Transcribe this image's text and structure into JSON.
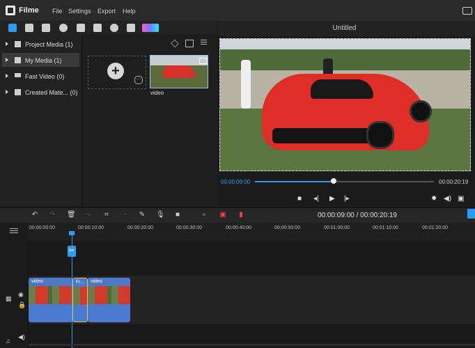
{
  "app": {
    "name": "Filme"
  },
  "menu": [
    "File",
    "Settings",
    "Export",
    "Help"
  ],
  "sidebar": {
    "items": [
      {
        "label": "Project Media (1)"
      },
      {
        "label": "My Media (1)"
      },
      {
        "label": "Fast Video (0)"
      },
      {
        "label": "Created Mate... (0)"
      }
    ]
  },
  "media": {
    "thumb_label": "video"
  },
  "preview": {
    "title": "Untitled",
    "current_time": "00:00:09:00",
    "end_time": "00:00:20:19",
    "progress_fraction": 0.44
  },
  "timeline": {
    "time_display": "00:00:09:00 / 00:00:20:19",
    "ruler": [
      "00:00:00:00",
      "00:00:10:00",
      "00:00:20:00",
      "00:00:30:00",
      "00:00:40:00",
      "00:00:50:00",
      "00:01:00:00",
      "00:01:10:00",
      "00:01:20:00"
    ],
    "clips": [
      {
        "label": "video"
      },
      {
        "label": "Fr..."
      },
      {
        "label": "video"
      }
    ]
  },
  "colors": {
    "accent": "#2e9bf0",
    "clip": "#4b7bd1",
    "selection": "#e8c23c"
  }
}
